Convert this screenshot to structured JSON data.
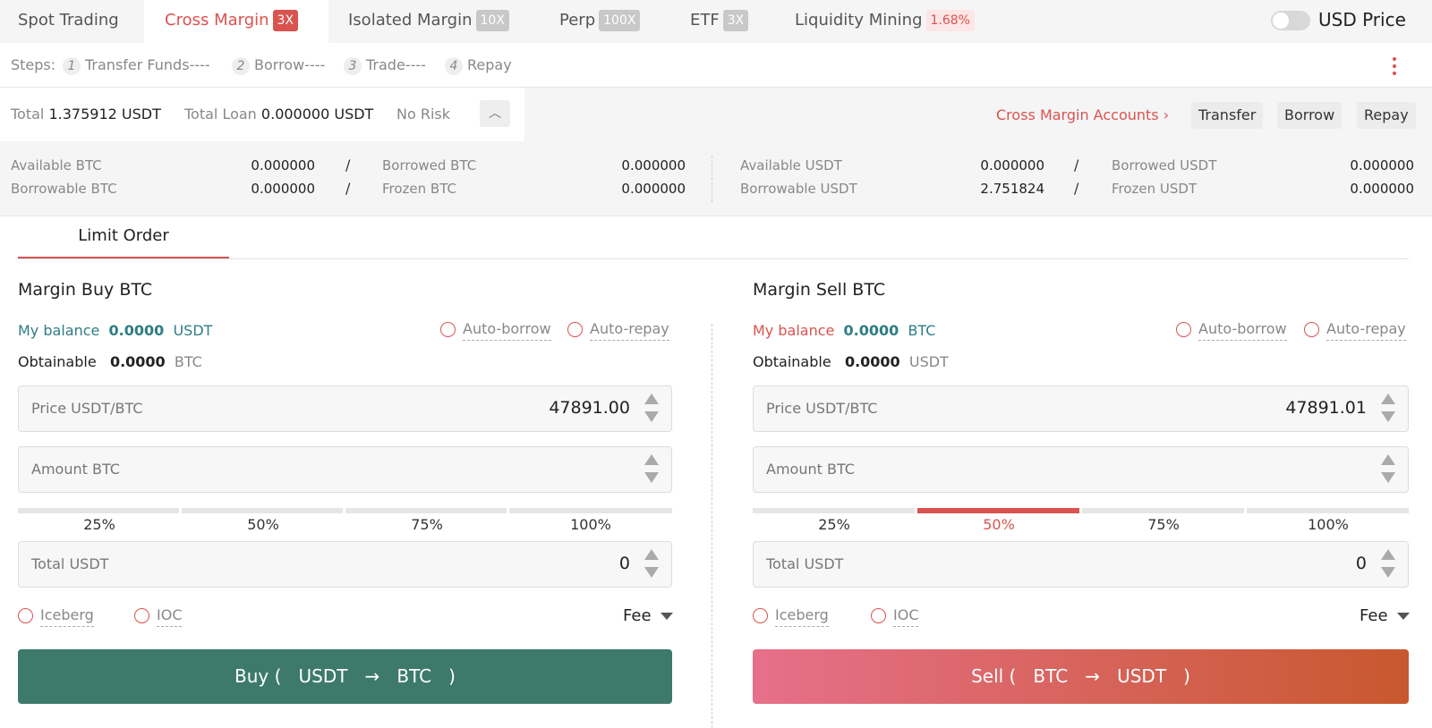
{
  "tabs": [
    {
      "label": "Spot Trading",
      "badge": ""
    },
    {
      "label": "Cross Margin",
      "badge": "3X"
    },
    {
      "label": "Isolated Margin",
      "badge": "10X"
    },
    {
      "label": "Perp",
      "badge": "100X"
    },
    {
      "label": "ETF",
      "badge": "3X"
    },
    {
      "label": "Liquidity Mining",
      "badge": "1.68%"
    }
  ],
  "active_tab": "Cross Margin",
  "usd_price": {
    "label": "USD Price",
    "enabled": false
  },
  "steps": {
    "prefix": "Steps:",
    "items": [
      {
        "num": "1",
        "label": "Transfer Funds----"
      },
      {
        "num": "2",
        "label": "Borrow----"
      },
      {
        "num": "3",
        "label": "Trade----"
      },
      {
        "num": "4",
        "label": "Repay"
      }
    ]
  },
  "totals": {
    "total_label": "Total",
    "total_value": "1.375912 USDT",
    "loan_label": "Total Loan",
    "loan_value": "0.000000 USDT",
    "risk": "No Risk",
    "accounts_link": "Cross Margin Accounts",
    "buttons": [
      "Transfer",
      "Borrow",
      "Repay"
    ]
  },
  "balances": {
    "btc": {
      "available_label": "Available BTC",
      "available": "0.000000",
      "borrowed_label": "Borrowed BTC",
      "borrowed": "0.000000",
      "borrowable_label": "Borrowable BTC",
      "borrowable": "0.000000",
      "frozen_label": "Frozen BTC",
      "frozen": "0.000000"
    },
    "usdt": {
      "available_label": "Available USDT",
      "available": "0.000000",
      "borrowed_label": "Borrowed USDT",
      "borrowed": "0.000000",
      "borrowable_label": "Borrowable USDT",
      "borrowable": "2.751824",
      "frozen_label": "Frozen USDT",
      "frozen": "0.000000"
    }
  },
  "order_tab": "Limit Order",
  "buy": {
    "title": "Margin Buy",
    "asset": "BTC",
    "balance_label": "My balance",
    "balance_value": "0.0000",
    "balance_unit": "USDT",
    "obtainable_label": "Obtainable",
    "obtainable_value": "0.0000",
    "obtainable_unit": "BTC",
    "auto_borrow": "Auto-borrow",
    "auto_repay": "Auto-repay",
    "price_label": "Price USDT/BTC",
    "price_value": "47891.00",
    "amount_label": "Amount BTC",
    "amount_value": "",
    "percentages": [
      "25%",
      "50%",
      "75%",
      "100%"
    ],
    "selected_percent": null,
    "total_label": "Total USDT",
    "total_value": "0",
    "iceberg": "Iceberg",
    "ioc": "IOC",
    "fee": "Fee",
    "button": {
      "action": "Buy (",
      "from": "USDT",
      "arrow": "→",
      "to": "BTC",
      "close": ")"
    }
  },
  "sell": {
    "title": "Margin Sell",
    "asset": "BTC",
    "balance_label": "My balance",
    "balance_value": "0.0000",
    "balance_unit": "BTC",
    "obtainable_label": "Obtainable",
    "obtainable_value": "0.0000",
    "obtainable_unit": "USDT",
    "auto_borrow": "Auto-borrow",
    "auto_repay": "Auto-repay",
    "price_label": "Price USDT/BTC",
    "price_value": "47891.01",
    "amount_label": "Amount BTC",
    "amount_value": "",
    "percentages": [
      "25%",
      "50%",
      "75%",
      "100%"
    ],
    "selected_percent": "50%",
    "total_label": "Total USDT",
    "total_value": "0",
    "iceberg": "Iceberg",
    "ioc": "IOC",
    "fee": "Fee",
    "button": {
      "action": "Sell (",
      "from": "BTC",
      "arrow": "→",
      "to": "USDT",
      "close": ")"
    }
  },
  "colors": {
    "accent": "#d9534f",
    "buy": "#3d7a6b",
    "sell_start": "#e6708a",
    "sell_end": "#c8582e",
    "teal": "#2f7d84"
  }
}
